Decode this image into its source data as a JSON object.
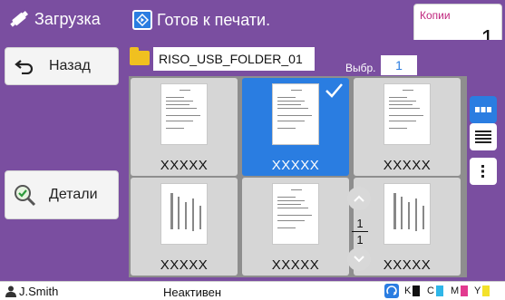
{
  "sidebar": {
    "title": "Загрузка",
    "back_label": "Назад",
    "details_label": "Детали"
  },
  "topbar": {
    "status_text": "Готов к печати.",
    "copies_label": "Копии",
    "copies_value": "1"
  },
  "folder": {
    "name": "RISO_USB_FOLDER_01",
    "select_label": "Выбр.",
    "select_value": "1"
  },
  "files": [
    {
      "name": "XXXXX",
      "selected": false
    },
    {
      "name": "XXXXX",
      "selected": true
    },
    {
      "name": "XXXXX",
      "selected": false
    },
    {
      "name": "XXXXX",
      "selected": false
    },
    {
      "name": "XXXXX",
      "selected": false
    },
    {
      "name": "XXXXX",
      "selected": false
    }
  ],
  "pager": {
    "current": "1",
    "total": "1"
  },
  "statusbar": {
    "user": "J.Smith",
    "state": "Неактивен",
    "ink": [
      {
        "label": "K",
        "color": "#111111"
      },
      {
        "label": "C",
        "color": "#2fb6e8"
      },
      {
        "label": "M",
        "color": "#e23a8f"
      },
      {
        "label": "Y",
        "color": "#f3e12a"
      }
    ]
  },
  "colors": {
    "accent": "#7a4ea0",
    "selection": "#2a7de1"
  },
  "icons": {
    "usb": "usb-icon",
    "back": "back-arrow-icon",
    "details": "magnifier-check-icon",
    "status": "print-ready-icon",
    "folder": "folder-icon",
    "grid_view": "grid-view-icon",
    "list_view": "list-view-icon",
    "more": "more-vertical-icon",
    "up": "chevron-up-icon",
    "down": "chevron-down-icon",
    "user": "user-icon",
    "network": "network-icon"
  }
}
